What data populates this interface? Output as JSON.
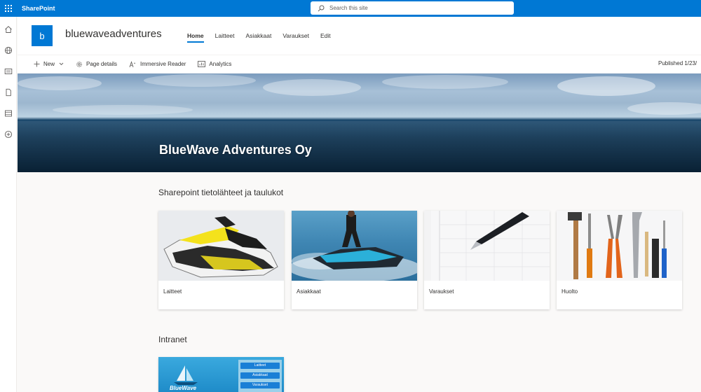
{
  "suite": {
    "app_name": "SharePoint",
    "search_placeholder": "Search this site"
  },
  "site": {
    "logo_letter": "b",
    "title": "bluewaveadventures",
    "nav": [
      {
        "label": "Home",
        "active": true
      },
      {
        "label": "Laitteet",
        "active": false
      },
      {
        "label": "Asiakkaat",
        "active": false
      },
      {
        "label": "Varaukset",
        "active": false
      },
      {
        "label": "Edit",
        "active": false
      }
    ]
  },
  "command_bar": {
    "new_label": "New",
    "page_details_label": "Page details",
    "immersive_reader_label": "Immersive Reader",
    "analytics_label": "Analytics",
    "published": "Published 1/23/"
  },
  "hero": {
    "title": "BlueWave Adventures Oy"
  },
  "sources_section": {
    "title": "Sharepoint tietolähteet ja taulukot",
    "cards": [
      {
        "label": "Laitteet"
      },
      {
        "label": "Asiakkaat"
      },
      {
        "label": "Varaukset"
      },
      {
        "label": "Huolto"
      }
    ]
  },
  "intranet_section": {
    "title": "Intranet",
    "thumbnail_logo_text": "BlueWave",
    "thumbnail_buttons": [
      "Laitteet",
      "Asiakkaat",
      "Varaukset"
    ]
  },
  "colors": {
    "brand": "#0078d4",
    "page_background": "#faf9f8"
  },
  "icons": {
    "suite": [
      "waffle-icon",
      "search-icon"
    ],
    "app_bar": [
      "home-icon",
      "globe-icon",
      "news-icon",
      "document-icon",
      "list-icon",
      "add-icon"
    ],
    "command_bar": [
      "plus-icon",
      "chevron-down-icon",
      "gear-icon",
      "immersive-reader-icon",
      "analytics-icon"
    ]
  }
}
